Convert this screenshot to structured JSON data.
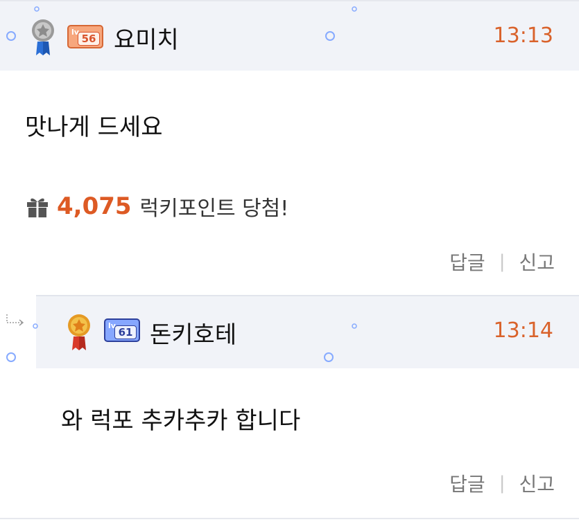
{
  "comments": [
    {
      "nickname": "요미치",
      "level": "56",
      "level_prefix": "lv",
      "time": "13:13",
      "content": "맛나게 드세요",
      "lucky": {
        "points": "4,075",
        "text": "럭키포인트 당첨!"
      },
      "actions": {
        "reply": "답글",
        "separator": "|",
        "report": "신고"
      }
    },
    {
      "nickname": "돈키호테",
      "level": "61",
      "level_prefix": "lv",
      "time": "13:14",
      "content": "와 럭포 추카추카 합니다",
      "actions": {
        "reply": "답글",
        "separator": "|",
        "report": "신고"
      }
    }
  ],
  "colors": {
    "accent": "#d9622b",
    "header_bg": "#f1f3f8",
    "level_orange": "#f7a77d",
    "level_blue": "#86a7ff"
  },
  "icons": {
    "silver_medal": "silver-medal-icon",
    "gold_medal": "gold-medal-icon",
    "gift": "gift-icon",
    "reply_arrow": "reply-arrow-icon"
  }
}
